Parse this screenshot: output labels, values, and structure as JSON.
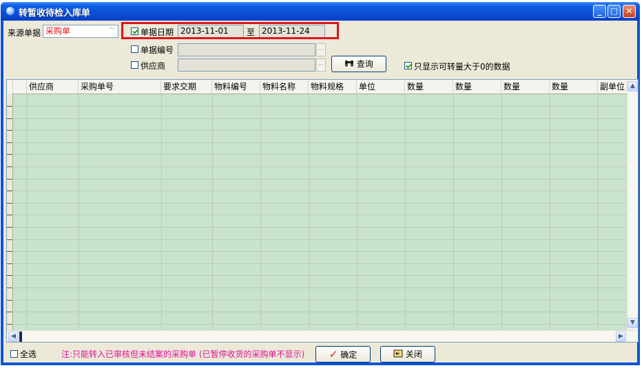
{
  "window": {
    "title": "转暂收待检入库单",
    "minimize_label": "_",
    "maximize_label": "□",
    "close_label": "✕"
  },
  "filters": {
    "source_label": "来源单据",
    "source_value": "采购单",
    "date_label": "单据日期",
    "date_checked": true,
    "date_from": "2013-11-01",
    "date_sep": "至",
    "date_to": "2013-11-24",
    "number_label": "单据编号",
    "number_checked": false,
    "supplier_label": "供应商",
    "supplier_checked": false,
    "browse_label": "...",
    "query_label": "查询",
    "only_positive_label": "只显示可转量大于0的数据",
    "only_positive_checked": true
  },
  "table": {
    "columns": [
      "供应商",
      "采购单号",
      "要求交期",
      "物料编号",
      "物料名称",
      "物料规格",
      "单位",
      "数量",
      "数量",
      "数量",
      "数量",
      "副单位"
    ]
  },
  "footer": {
    "select_all_label": "全选",
    "select_all_checked": false,
    "note": "注:只能转入已审核但未结案的采购单 (已暂停收货的采购单不显示)",
    "ok_label": "确定",
    "close_label": "关闭"
  },
  "colors": {
    "accent_red": "#e0111b",
    "grid_bg": "#c9e3cc",
    "note_color": "#e0119a",
    "title_blue": "#0a53d8"
  }
}
